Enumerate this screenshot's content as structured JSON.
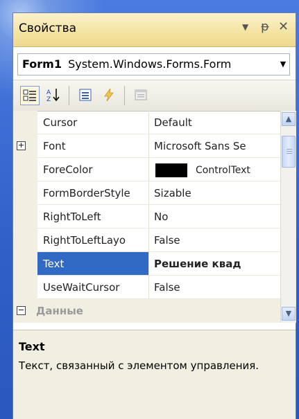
{
  "window": {
    "title": "Свойства",
    "icons": {
      "dropdown": "▼",
      "pin": "ᵽ",
      "close": "✕"
    }
  },
  "object_selector": {
    "name": "Form1",
    "type": "System.Windows.Forms.Form"
  },
  "toolbar": {
    "buttons": [
      {
        "name": "categorized-icon",
        "pressed": true
      },
      {
        "name": "alphabetical-icon",
        "pressed": false
      },
      {
        "name": "properties-icon",
        "pressed": false
      },
      {
        "name": "events-icon",
        "pressed": false
      },
      {
        "name": "property-pages-icon",
        "pressed": false
      }
    ]
  },
  "grid": {
    "rows": [
      {
        "name": "Cursor",
        "value": "Default"
      },
      {
        "name": "Font",
        "value": "Microsoft Sans Se",
        "expander": "+"
      },
      {
        "name": "ForeColor",
        "value": "ControlText",
        "swatch": "#000000"
      },
      {
        "name": "FormBorderStyle",
        "value": "Sizable"
      },
      {
        "name": "RightToLeft",
        "value": "No"
      },
      {
        "name": "RightToLeftLayo",
        "value": "False"
      },
      {
        "name": "Text",
        "value": "Решение квад",
        "selected": true
      },
      {
        "name": "UseWaitCursor",
        "value": "False"
      },
      {
        "name": "Данные",
        "category": true,
        "expander": "−"
      }
    ]
  },
  "description": {
    "title": "Text",
    "text": "Текст, связанный с элементом управления."
  },
  "colors": {
    "selection": "#316ac5",
    "title_bar": "#f4e4a4",
    "desktop": "#2f60c8"
  }
}
